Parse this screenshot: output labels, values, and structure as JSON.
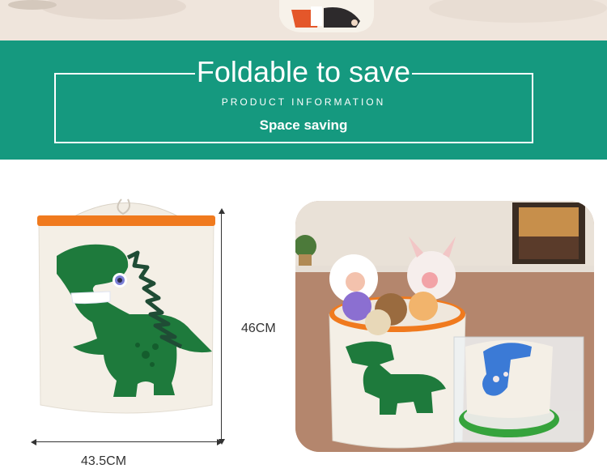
{
  "banner": {
    "title": "Foldable to save",
    "subtitle": "PRODUCT INFORMATION",
    "caption": "Space saving"
  },
  "dimensions": {
    "height": "46CM",
    "width": "43.5CM"
  },
  "colors": {
    "banner": "#15997f",
    "dino_green": "#1e7a3c",
    "rim_orange": "#f07a1e",
    "canvas": "#f4efe6"
  },
  "images": {
    "top_strip": "toy-basket-photo-cropped",
    "product": "dinosaur-storage-basket",
    "scene": "basket-with-plush-toys-and-folded-basket"
  }
}
